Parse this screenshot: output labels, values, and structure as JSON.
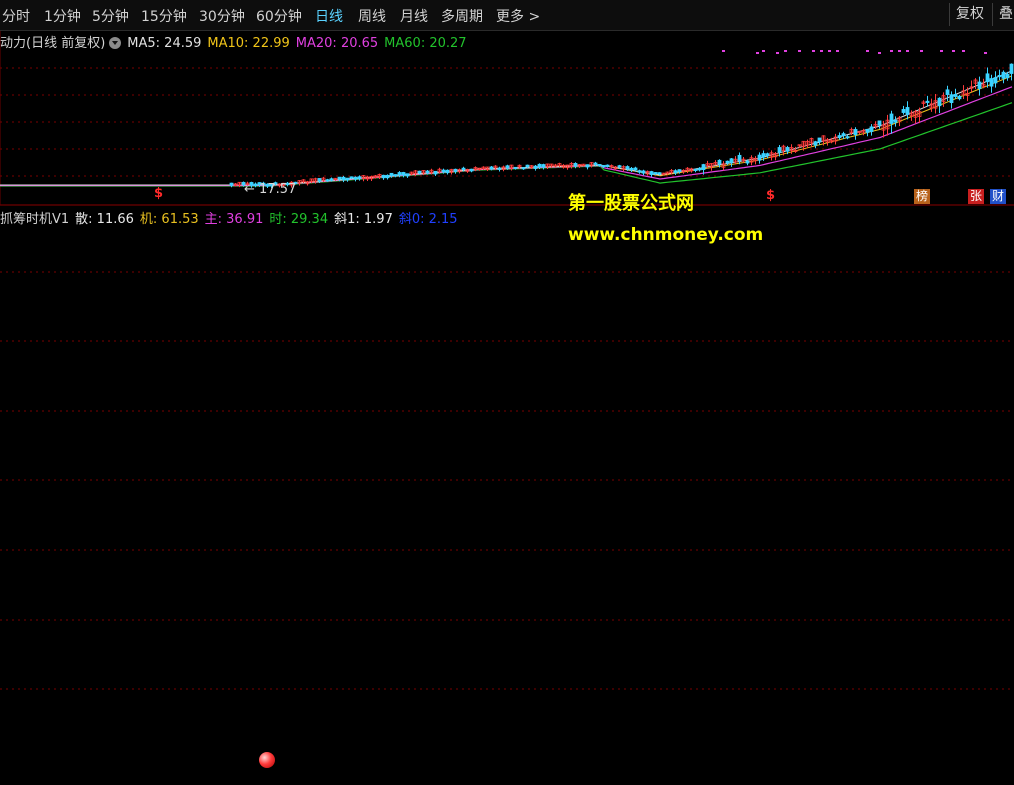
{
  "toolbar": {
    "periods": [
      "分时",
      "1分钟",
      "5分钟",
      "15分钟",
      "30分钟",
      "60分钟",
      "日线",
      "周线",
      "月线",
      "多周期",
      "更多 >"
    ],
    "active_period": "日线",
    "adjust_button": "复权",
    "overlay_button": "叠"
  },
  "main_legend": {
    "title": "动力(日线 前复权)",
    "items": [
      {
        "label": "MA5: 24.59",
        "color": "#e0e0e0"
      },
      {
        "label": "MA10: 22.99",
        "color": "#f0c419"
      },
      {
        "label": "MA20: 20.65",
        "color": "#e040e0"
      },
      {
        "label": "MA60: 20.27",
        "color": "#22c22c"
      }
    ]
  },
  "price_annotation": "← 17.57",
  "event_markers": {
    "s1": "$",
    "s2": "$"
  },
  "tags": {
    "bang": {
      "label": "榜",
      "color": "#b8621b"
    },
    "zhang": {
      "label": "张",
      "color": "#c81f1f"
    },
    "cai": {
      "label": "财",
      "color": "#2050c8"
    }
  },
  "indicator_legend": {
    "title": "抓筹时机V1",
    "items": [
      {
        "label": "散: 11.66",
        "color": "#e8e8e8"
      },
      {
        "label": "机: 61.53",
        "color": "#e8c020"
      },
      {
        "label": "主: 36.91",
        "color": "#e040e0"
      },
      {
        "label": "时: 29.34",
        "color": "#22c22c"
      },
      {
        "label": "斜1: 1.97",
        "color": "#e8e8e8"
      },
      {
        "label": "斜0: 2.15",
        "color": "#2040ff"
      }
    ]
  },
  "watermark": {
    "line1": "第一股票公式网",
    "line2": "www.chnmoney.com",
    "color": "#ffff00"
  },
  "colors": {
    "grid": "#7a0000",
    "up": "#ff3b3b",
    "down": "#3bd3ff",
    "background": "#000000"
  }
}
